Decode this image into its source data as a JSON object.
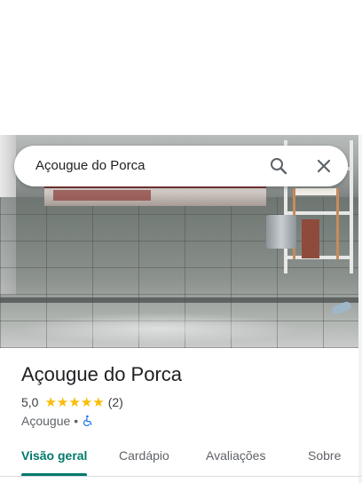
{
  "search": {
    "query": "Açougue do Porca"
  },
  "place": {
    "name": "Açougue do Porca",
    "rating": "5,0",
    "stars": 5,
    "review_count": "(2)",
    "category": "Açougue",
    "separator": "•",
    "accessibility_icon": "wheelchair-icon"
  },
  "tabs": [
    {
      "label": "Visão geral",
      "active": true
    },
    {
      "label": "Cardápio",
      "active": false
    },
    {
      "label": "Avaliações",
      "active": false
    },
    {
      "label": "Sobre",
      "active": false
    }
  ],
  "colors": {
    "accent": "#00796b",
    "star": "#fbbc04",
    "accessibility": "#1a73e8"
  }
}
